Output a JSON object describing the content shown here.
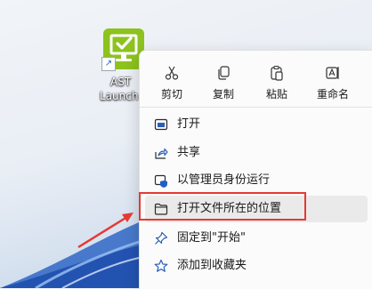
{
  "desktop": {
    "shortcut_label_line1": "AST",
    "shortcut_label_line2": "Launch",
    "icon": "ast-launcher-monitor-check-icon",
    "tile_color": "#8dc21f"
  },
  "context_menu": {
    "quick_actions": [
      {
        "label": "剪切",
        "icon": "scissors-icon"
      },
      {
        "label": "复制",
        "icon": "copy-icon"
      },
      {
        "label": "粘贴",
        "icon": "paste-icon"
      },
      {
        "label": "重命名",
        "icon": "rename-icon"
      }
    ],
    "items": [
      {
        "label": "打开",
        "icon": "open-app-icon"
      },
      {
        "label": "共享",
        "icon": "share-icon"
      },
      {
        "label": "以管理员身份运行",
        "icon": "admin-shield-icon"
      },
      {
        "label": "打开文件所在的位置",
        "icon": "folder-icon",
        "highlighted": true
      },
      {
        "label": "固定到\"开始\"",
        "icon": "pin-icon"
      },
      {
        "label": "添加到收藏夹",
        "icon": "star-icon"
      }
    ]
  },
  "annotation": {
    "highlight_color": "#e53935"
  }
}
